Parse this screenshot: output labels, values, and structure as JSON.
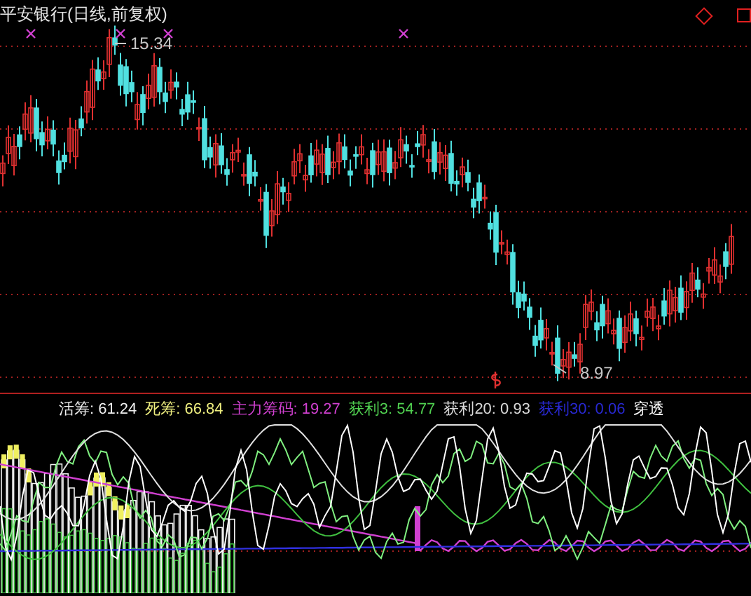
{
  "chart": {
    "title": "平安银行(日线,前复权)",
    "high_label": "15.34",
    "low_label": "8.97"
  },
  "legend": [
    {
      "text": "活筹: 61.24",
      "color": "#f0f0f0"
    },
    {
      "text": "死筹: 66.84",
      "color": "#f0f080"
    },
    {
      "text": "主力筹码: 19.27",
      "color": "#d040d0"
    },
    {
      "text": "获利3: 54.77",
      "color": "#50d050"
    },
    {
      "text": "获利20: 0.93",
      "color": "#d8d8d8"
    },
    {
      "text": "获利30: 0.06",
      "color": "#2828d0"
    },
    {
      "text": "穿透",
      "color": "#ffffff"
    }
  ]
}
